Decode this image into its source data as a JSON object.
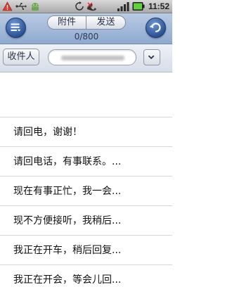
{
  "status_bar": {
    "time": "11:52",
    "icons": [
      "warning-icon",
      "usb-icon",
      "android-icon",
      "sync-icon",
      "missed-call-icon",
      "signal-icon",
      "battery-icon"
    ]
  },
  "header": {
    "menu_icon": "menu-icon",
    "attach_label": "附件",
    "send_label": "发送",
    "char_count": "0/800",
    "back_icon": "back-icon"
  },
  "recipient": {
    "label": "收件人",
    "dropdown_icon": "chevron-down-icon"
  },
  "quick_replies": [
    "请回电，谢谢！",
    "请回电话，有事联系。...",
    "现在有事正忙，我一会...",
    "现不方便接听，我稍后...",
    "我正在开车，稍后回复...",
    "我正在开会，等会儿回..."
  ],
  "colors": {
    "header_top": "#b9cbe4",
    "header_bottom": "#8fa9cf",
    "round_button": "#284f93",
    "battery": "#5fd13a"
  }
}
